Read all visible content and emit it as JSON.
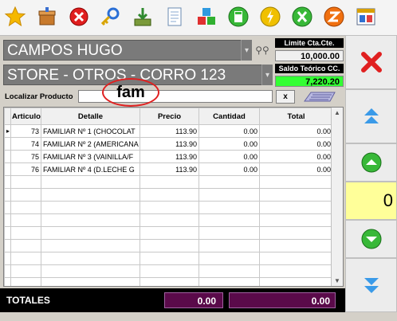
{
  "toolbar": {
    "icons": [
      "star-icon",
      "box-icon",
      "cancel-icon",
      "key-search-icon",
      "download-icon",
      "document-icon",
      "cubes-icon",
      "calculator-icon",
      "lightning-icon",
      "excel-icon",
      "zeta-icon",
      "window-icon"
    ]
  },
  "customer": {
    "name": "CAMPOS HUGO"
  },
  "store": {
    "name": "STORE - OTROS - CORRO 123"
  },
  "credit": {
    "limit_label": "Limite Cta.Cte.",
    "limit_value": "10,000.00",
    "balance_label": "Saldo Teórico CC.",
    "balance_value": "7,220.20"
  },
  "search": {
    "label": "Localizar Producto",
    "value": "",
    "clear_label": "x",
    "annotation": "fam"
  },
  "table": {
    "columns": [
      "Articulo",
      "Detalle",
      "Precio",
      "Cantidad",
      "Total"
    ],
    "rows": [
      {
        "articulo": "73",
        "detalle": "FAMILIAR Nº 1 (CHOCOLAT",
        "precio": "113.90",
        "cantidad": "0.00",
        "total": "0.00"
      },
      {
        "articulo": "74",
        "detalle": "FAMILIAR Nº 2 (AMERICANA",
        "precio": "113.90",
        "cantidad": "0.00",
        "total": "0.00"
      },
      {
        "articulo": "75",
        "detalle": "FAMILIAR Nº 3 (VAINILLA/F",
        "precio": "113.90",
        "cantidad": "0.00",
        "total": "0.00"
      },
      {
        "articulo": "76",
        "detalle": "FAMILIAR Nº 4 (D.LECHE G",
        "precio": "113.90",
        "cantidad": "0.00",
        "total": "0.00"
      }
    ]
  },
  "totals": {
    "label": "TOTALES",
    "quantity": "0.00",
    "amount": "0.00"
  },
  "side": {
    "counter": "0"
  },
  "colors": {
    "balance_bg": "#33ff33",
    "limit_bg": "#f0f0f0",
    "counter_bg": "#ffff99",
    "totals_box": "#5a0a4a"
  }
}
